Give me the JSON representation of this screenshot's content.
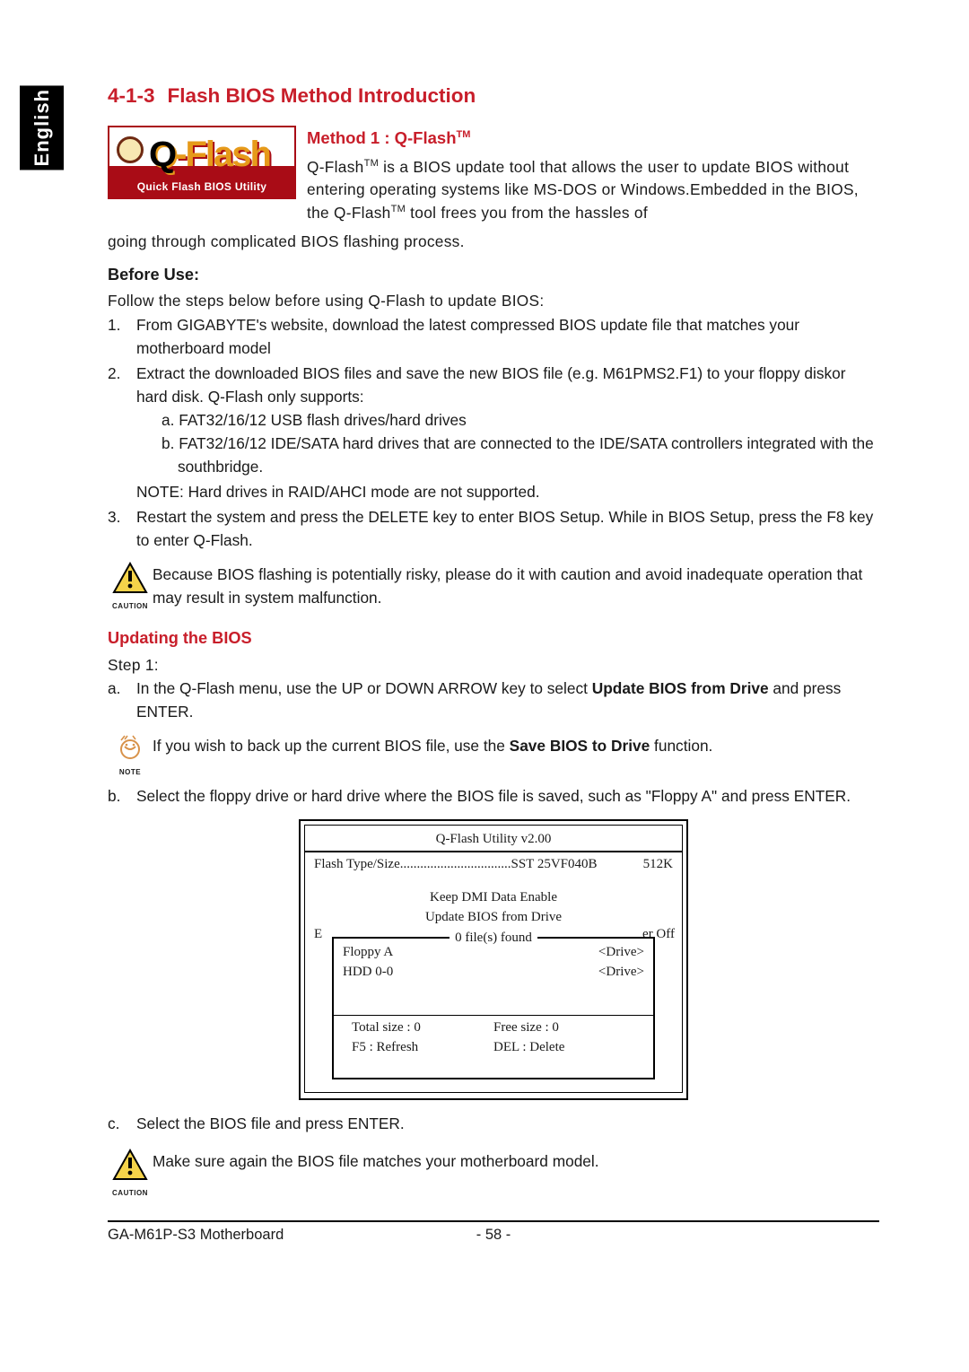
{
  "lang_tab": "English",
  "section_title_num": "4-1-3",
  "section_title": "Flash BIOS Method Introduction",
  "qflash_logo": {
    "main": "Q-Flash",
    "sub": "Quick Flash BIOS Utility"
  },
  "method1": {
    "title_a": "Method 1 : Q-Flash",
    "tm": "TM",
    "desc_a": "Q-Flash",
    "desc_b": " is a BIOS update tool that allows the user to update BIOS without entering operating systems like MS-DOS or Windows.Embedded in the BIOS, the Q-Flash",
    "desc_c": " tool frees you from the hassles of",
    "desc_cont": "going through complicated BIOS flashing process."
  },
  "before_use": {
    "heading": "Before Use:",
    "intro": "Follow the steps below before using Q-Flash to update BIOS:",
    "items": [
      {
        "mk": "1.",
        "text": "From GIGABYTE's website, download the latest compressed BIOS update file that matches your motherboard model"
      },
      {
        "mk": "2.",
        "text": "Extract the downloaded BIOS files and save the new BIOS file (e.g. M61PMS2.F1) to your floppy diskor hard disk. Q-Flash only supports:",
        "sub_a": "a. FAT32/16/12 USB flash drives/hard drives",
        "sub_b": "b. FAT32/16/12 IDE/SATA hard drives that are connected to the IDE/SATA controllers integrated with the southbridge.",
        "note": "NOTE: Hard drives in RAID/AHCI mode are not supported."
      },
      {
        "mk": "3.",
        "text": "Restart the system and press the DELETE key to enter BIOS Setup. While in BIOS Setup, press the F8 key to enter Q-Flash."
      }
    ]
  },
  "caution1": {
    "label": "CAUTION",
    "text": "Because BIOS flashing is potentially risky, please do it with caution and avoid inadequate operation that may result in system malfunction."
  },
  "updating": {
    "heading": "Updating the BIOS",
    "step1": "Step 1:",
    "a": {
      "mk": "a.",
      "pre": "In the Q-Flash menu, use the UP or DOWN ARROW key to select ",
      "bold": "Update BIOS from Drive",
      "post": " and press ENTER."
    },
    "note": {
      "label": "NOTE",
      "pre": "If you wish to back up the current BIOS file, use the ",
      "bold": "Save BIOS to Drive",
      "post": " function."
    },
    "b": {
      "mk": "b.",
      "text": "Select the floppy drive or hard drive where the BIOS file is saved, such as \"Floppy A\" and press ENTER."
    },
    "c": {
      "mk": "c.",
      "text": "Select the BIOS file and press ENTER."
    }
  },
  "qflash_box": {
    "title": "Q-Flash Utility v2.00",
    "flash_type_label": "Flash Type/Size.................................",
    "flash_type_value": "SST 25VF040B",
    "flash_size": "512K",
    "keep_dmi": "Keep DMI Data    Enable",
    "update_from": "Update BIOS from Drive",
    "files_found": "0 file(s) found",
    "side_left": "E",
    "side_right": "er Off",
    "drives": [
      {
        "name": "Floppy A",
        "ind": "<Drive>"
      },
      {
        "name": "HDD 0-0",
        "ind": "<Drive>"
      }
    ],
    "total_size": "Total size : 0",
    "free_size": "Free size : 0",
    "f5": "F5 : Refresh",
    "del": "DEL : Delete"
  },
  "caution2": {
    "label": "CAUTION",
    "text": "Make sure again the BIOS file matches your motherboard model."
  },
  "footer": {
    "left": "GA-M61P-S3 Motherboard",
    "center": "- 58 -"
  }
}
